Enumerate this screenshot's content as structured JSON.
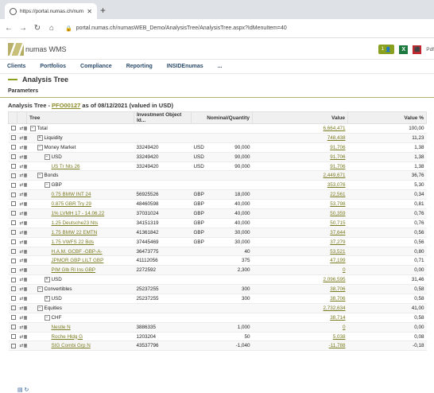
{
  "browser": {
    "tab_title": "https://portal.numas.ch/numasW",
    "url": "portal.numas.ch/numasWEB_Demo/AnalysisTree/AnalysisTree.aspx?IdMenuItem=40"
  },
  "app": {
    "logo_text": "numas WMS",
    "user_badge": "1",
    "pdf_label": "Pdf"
  },
  "menu": [
    "Clients",
    "Portfolios",
    "Compliance",
    "Reporting",
    "INSIDEnumas",
    "..."
  ],
  "page": {
    "title": "Analysis Tree",
    "params_label": "Parameters",
    "subtitle_prefix": "Analysis Tree - ",
    "portfolio_link": "PFO00127",
    "subtitle_suffix": " as of 08/12/2021 (valued in USD)"
  },
  "table": {
    "columns": [
      "Tree",
      "Investment Object Id...",
      "Nominal/Quantity",
      "",
      "Value",
      "Value %"
    ],
    "rows": [
      {
        "indent": 0,
        "exp": "⊟",
        "label": "Total",
        "link": false,
        "id": "",
        "ccy": "",
        "qty": "",
        "value": "6,664,471",
        "pct": "100,00"
      },
      {
        "indent": 1,
        "exp": "⊞",
        "label": "Liquidity",
        "link": false,
        "id": "",
        "ccy": "",
        "qty": "",
        "value": "748,438",
        "pct": "11,23"
      },
      {
        "indent": 1,
        "exp": "⊟",
        "label": "Money Market",
        "link": false,
        "id": "33249420",
        "ccy": "USD",
        "qty": "90,000",
        "value": "91,706",
        "pct": "1,38"
      },
      {
        "indent": 2,
        "exp": "⊟",
        "label": "USD",
        "link": false,
        "id": "33249420",
        "ccy": "USD",
        "qty": "90,000",
        "value": "91,706",
        "pct": "1,38"
      },
      {
        "indent": 3,
        "exp": "",
        "label": "US Tr Nts 26",
        "link": true,
        "id": "33249420",
        "ccy": "USD",
        "qty": "90,000",
        "value": "91,706",
        "pct": "1,38"
      },
      {
        "indent": 1,
        "exp": "⊟",
        "label": "Bonds",
        "link": false,
        "id": "",
        "ccy": "",
        "qty": "",
        "value": "2,449,671",
        "pct": "36,76"
      },
      {
        "indent": 2,
        "exp": "⊟",
        "label": "GBP",
        "link": false,
        "id": "",
        "ccy": "",
        "qty": "",
        "value": "353,076",
        "pct": "5,30"
      },
      {
        "indent": 3,
        "exp": "",
        "label": "0.75 BMW INT 24",
        "link": true,
        "id": "56925526",
        "ccy": "GBP",
        "qty": "18,000",
        "value": "22,561",
        "pct": "0,34"
      },
      {
        "indent": 3,
        "exp": "",
        "label": "0.875 GBR Try 29",
        "link": true,
        "id": "48460598",
        "ccy": "GBP",
        "qty": "40,000",
        "value": "53,798",
        "pct": "0,81"
      },
      {
        "indent": 3,
        "exp": "",
        "label": "1% LVMH 17 - 14.06.22",
        "link": true,
        "id": "37031024",
        "ccy": "GBP",
        "qty": "40,000",
        "value": "50,359",
        "pct": "0,76"
      },
      {
        "indent": 3,
        "exp": "",
        "label": "1.25 Deutsche23 Nts",
        "link": true,
        "id": "34151319",
        "ccy": "GBP",
        "qty": "40,000",
        "value": "50,715",
        "pct": "0,76"
      },
      {
        "indent": 3,
        "exp": "",
        "label": "1.75 BMW 22 EMTN",
        "link": true,
        "id": "41361842",
        "ccy": "GBP",
        "qty": "30,000",
        "value": "37,644",
        "pct": "0,56"
      },
      {
        "indent": 3,
        "exp": "",
        "label": "1.75 VWFS 22 Bds",
        "link": true,
        "id": "37445469",
        "ccy": "GBP",
        "qty": "30,000",
        "value": "37,279",
        "pct": "0,56"
      },
      {
        "indent": 3,
        "exp": "",
        "label": "H.A.M. GCBF -GBP-A-",
        "link": true,
        "id": "36473775",
        "ccy": "",
        "qty": "40",
        "value": "53,521",
        "pct": "0,80"
      },
      {
        "indent": 3,
        "exp": "",
        "label": "JPMOR GBP LILT GBP",
        "link": true,
        "id": "41112056",
        "ccy": "",
        "qty": "375",
        "value": "47,199",
        "pct": "0,71"
      },
      {
        "indent": 3,
        "exp": "",
        "label": "PIM Glb Rl Ins GBP",
        "link": true,
        "id": "2272592",
        "ccy": "",
        "qty": "2,300",
        "value": "0",
        "pct": "0,00"
      },
      {
        "indent": 2,
        "exp": "⊞",
        "label": "USD",
        "link": false,
        "id": "",
        "ccy": "",
        "qty": "",
        "value": "2,096,595",
        "pct": "31,46"
      },
      {
        "indent": 1,
        "exp": "⊟",
        "label": "Convertibles",
        "link": false,
        "id": "25237255",
        "ccy": "",
        "qty": "300",
        "value": "38,706",
        "pct": "0,58"
      },
      {
        "indent": 2,
        "exp": "⊞",
        "label": "USD",
        "link": false,
        "id": "25237255",
        "ccy": "",
        "qty": "300",
        "value": "38,706",
        "pct": "0,58"
      },
      {
        "indent": 1,
        "exp": "⊟",
        "label": "Equities",
        "link": false,
        "id": "",
        "ccy": "",
        "qty": "",
        "value": "2,732,634",
        "pct": "41,00"
      },
      {
        "indent": 2,
        "exp": "⊟",
        "label": "CHF",
        "link": false,
        "id": "",
        "ccy": "",
        "qty": "",
        "value": "38,714",
        "pct": "0,58"
      },
      {
        "indent": 3,
        "exp": "",
        "label": "Nestle N",
        "link": true,
        "id": "3886335",
        "ccy": "",
        "qty": "1,000",
        "value": "0",
        "pct": "0,00"
      },
      {
        "indent": 3,
        "exp": "",
        "label": "Roche Hldg G",
        "link": true,
        "id": "1203204",
        "ccy": "",
        "qty": "50",
        "value": "5,038",
        "pct": "0,08"
      },
      {
        "indent": 3,
        "exp": "",
        "label": "SIG Combi Grp N",
        "link": true,
        "id": "43537796",
        "ccy": "",
        "qty": "-1,040",
        "value": "-11,788",
        "pct": "-0,18"
      }
    ]
  }
}
